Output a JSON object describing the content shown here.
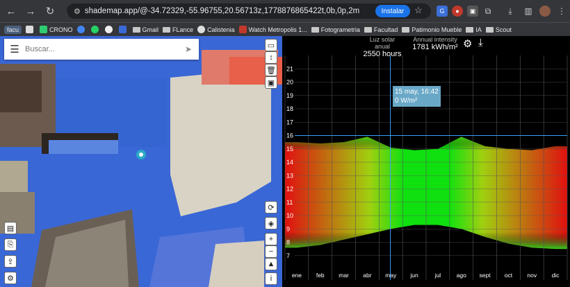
{
  "browser": {
    "url": "shademap.app/@-34.72329,-55.96755,20.56713z,1778876865422t,0b,0p,2m",
    "install_label": "Instalar",
    "bookmarks": [
      {
        "label": "facu",
        "kind": "tag"
      },
      {
        "label": "",
        "kind": "icon"
      },
      {
        "label": "CRONO",
        "kind": "site"
      },
      {
        "label": "",
        "kind": "icon"
      },
      {
        "label": "",
        "kind": "icon"
      },
      {
        "label": "",
        "kind": "icon"
      },
      {
        "label": "",
        "kind": "icon"
      },
      {
        "label": "Gmail",
        "kind": "folder"
      },
      {
        "label": "FLance",
        "kind": "folder"
      },
      {
        "label": "Calistenia",
        "kind": "site"
      },
      {
        "label": "Watch Metropolis 1...",
        "kind": "site"
      },
      {
        "label": "Fotogrametria",
        "kind": "folder"
      },
      {
        "label": "Facultad",
        "kind": "folder"
      },
      {
        "label": "Patimonio Mueble",
        "kind": "folder"
      },
      {
        "label": "IA",
        "kind": "folder"
      },
      {
        "label": "Scout",
        "kind": "folder"
      }
    ]
  },
  "map": {
    "search_placeholder": "Buscar...",
    "tools_top": [
      "polygon-tool",
      "height-tool",
      "delete-tool",
      "save-tool"
    ],
    "tools_left": [
      "open-file",
      "import-file",
      "share",
      "settings"
    ],
    "tools_right": [
      "rotate",
      "layers",
      "zoom-in",
      "zoom-out",
      "compass"
    ]
  },
  "panel": {
    "annual_light_label": "Luz solar anual",
    "annual_light_value": "2550 hours",
    "annual_intensity_label": "Annual intensity",
    "annual_intensity_value": "1781 kWh/m²",
    "tooltip_line1": "15 may, 16:42",
    "tooltip_line2": "0 W/m²"
  },
  "chart_data": {
    "type": "heatmap",
    "title": "",
    "xlabel": "",
    "ylabel": "",
    "ylim": [
      6,
      22
    ],
    "yticks": [
      7,
      8,
      9,
      10,
      11,
      12,
      13,
      14,
      15,
      16,
      17,
      18,
      19,
      20,
      21
    ],
    "months": [
      "ene",
      "feb",
      "mar",
      "abr",
      "may",
      "jun",
      "jul",
      "ago",
      "sept",
      "oct",
      "nov",
      "dic"
    ],
    "cursor_month_pos": 4.48,
    "cursor_hour": 16.0,
    "sunrise_hour": [
      7.6,
      7.8,
      8.2,
      8.6,
      9.0,
      9.3,
      9.3,
      9.0,
      8.4,
      7.9,
      7.6,
      7.5
    ],
    "sunset_hour": [
      15.5,
      15.4,
      15.5,
      15.9,
      15.1,
      14.9,
      15.0,
      15.9,
      15.2,
      15.0,
      14.9,
      15.2
    ],
    "colors": {
      "sun_high": "#e01010",
      "sun_low": "#10e010",
      "night": "#000000",
      "grid": "#555555",
      "cursor": "#3aa0ff"
    }
  }
}
